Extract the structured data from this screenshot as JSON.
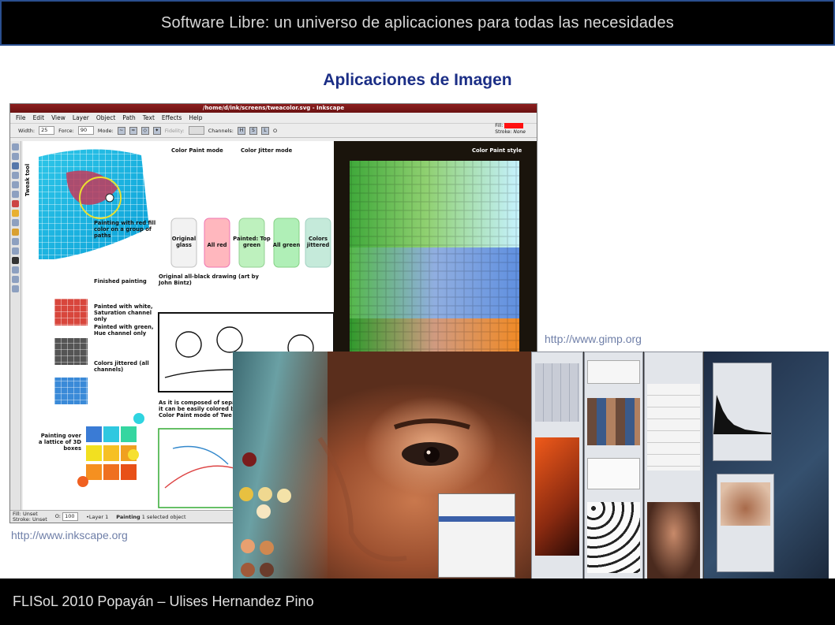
{
  "slide": {
    "title": "Software Libre: un universo de aplicaciones para todas las necesidades",
    "subtitle": "Aplicaciones de Imagen",
    "footer": "FLISoL 2010 Popayán – Ulises Hernandez Pino"
  },
  "inkscape": {
    "url": "http://www.inkscape.org",
    "window_title": "/home/d/ink/screens/tweacolor.svg - Inkscape",
    "menu": [
      "File",
      "Edit",
      "View",
      "Layer",
      "Object",
      "Path",
      "Text",
      "Effects",
      "Help"
    ],
    "toolbar": {
      "width_label": "Width:",
      "width_value": "25",
      "force_label": "Force:",
      "force_value": "90",
      "mode_label": "Mode:",
      "fidelity_label": "Fidelity:",
      "channels_label": "Channels:",
      "channels": [
        "H",
        "S",
        "L",
        "O"
      ],
      "fill_label": "Fill:",
      "stroke_label": "Stroke:",
      "stroke_value": "None"
    },
    "canvas_labels": {
      "color_paint_mode": "Color Paint mode",
      "color_jitter_mode": "Color Jitter mode",
      "color_paint_style": "Color Paint style",
      "tweak_tool": "Tweak tool",
      "painting_note": "Painting with red fill color on a group of paths",
      "glasses": [
        "Original glass",
        "All red",
        "Painted: Top green",
        "All green",
        "Colors jittered"
      ],
      "finished_painting": "Finished painting",
      "painted_white": "Painted with white, Saturation channel only",
      "painted_green": "Painted with green, Hue channel only",
      "colors_jittered": "Colors jittered (all channels)",
      "drawing_title": "Original all-black drawing (art by John Bintz)",
      "composed_note": "As it is composed of separate s it can be easily colored by the Color Paint mode of Twe",
      "lattice_note": "Painting over a lattice of 3D boxes"
    },
    "status": {
      "fill_label": "Fill:",
      "fill_value": "Unset",
      "stroke_label": "Stroke:",
      "stroke_value": "Unset",
      "opacity_label": "O:",
      "opacity_value": "100",
      "layer": "•Layer 1",
      "message_bold": "Painting",
      "message": "1 selected object"
    }
  },
  "gimp": {
    "url": "http://www.gimp.org"
  },
  "colors": {
    "header_border": "#2a4f8f",
    "subtitle": "#1b2e86",
    "url_text": "#6f7fa8",
    "inkscape_title": "#8d1f1f",
    "fill_swatch": "#ff1010"
  },
  "icons": [
    "tweak-mode-icon",
    "select-tool-icon",
    "node-tool-icon",
    "zoom-tool-icon",
    "rect-tool-icon",
    "ellipse-tool-icon",
    "pencil-tool-icon",
    "text-tool-icon",
    "gradient-tool-icon",
    "dropper-tool-icon"
  ]
}
